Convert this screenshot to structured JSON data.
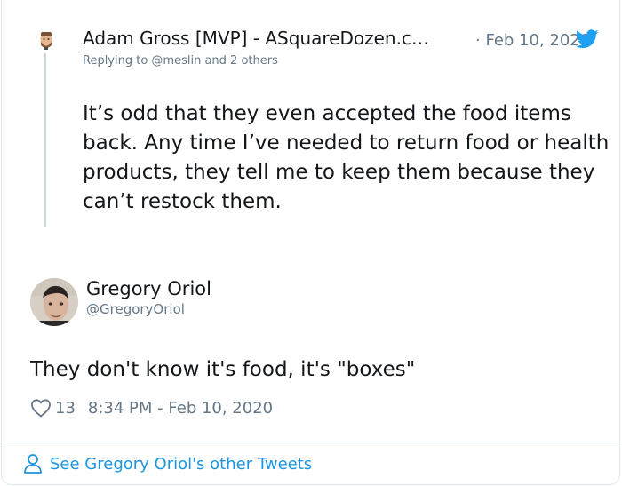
{
  "parent_tweet": {
    "author": "Adam Gross [MVP] - ASquareDozen.c…",
    "date": "· Feb 10, 2020",
    "replying_to": "Replying to @meslin and 2 others",
    "text": "It’s odd that they even accepted the food items back. Any time I’ve needed to return food or health products, they tell me to keep them because they can’t restock them."
  },
  "tweet": {
    "author_name": "Gregory Oriol",
    "author_handle": "@GregoryOriol",
    "text": "They don't know it's food, it's \"boxes\"",
    "likes": "13",
    "timestamp": "8:34 PM - Feb 10, 2020"
  },
  "footer": {
    "link_label": "See Gregory Oriol's other Tweets"
  },
  "icons": {
    "logo": "twitter-bird-icon",
    "like": "heart-icon",
    "profile": "person-icon"
  },
  "colors": {
    "twitter_blue": "#1da1f2",
    "link_blue": "#1b95e0",
    "secondary_text": "#657786",
    "primary_text": "#14171a",
    "border": "#e1e8ed"
  }
}
